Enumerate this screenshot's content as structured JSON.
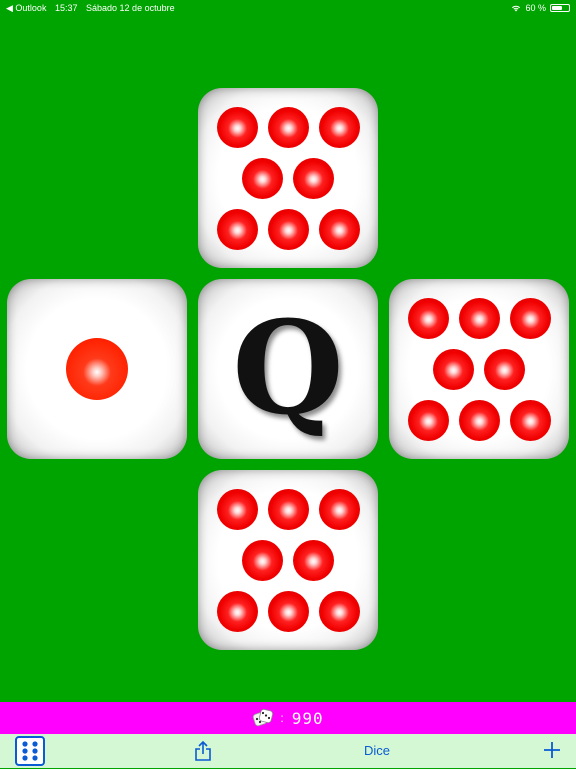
{
  "status_bar": {
    "back_app": "◀ Outlook",
    "time": "15:37",
    "date": "Sábado 12 de octubre",
    "battery": "60 %",
    "battery_level": 0.6
  },
  "board": {
    "top_die": {
      "pips": 8
    },
    "left_die": {
      "pips": 1
    },
    "center_die": {
      "label": "Q"
    },
    "right_die": {
      "pips": 8
    },
    "bottom_die": {
      "pips": 8
    }
  },
  "score": {
    "separator": ":",
    "value": "990"
  },
  "toolbar": {
    "dice_icon": "six-dots-icon",
    "share_icon": "share-icon",
    "title": "Dice",
    "add_icon": "plus-icon",
    "accent_color": "#0a5bd4"
  },
  "colors": {
    "table": "#00a400",
    "score_bar": "#ff00ff",
    "toolbar": "#d4f7d4",
    "pip": "#ff0000"
  }
}
